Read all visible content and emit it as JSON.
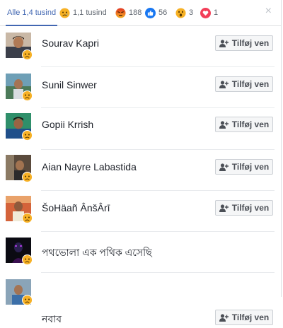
{
  "tabs": [
    {
      "id": "all",
      "label": "Alle 1,4 tusind",
      "active": true
    },
    {
      "id": "sad",
      "count": "1,1 tusind",
      "icon": "sad-reaction-icon",
      "color": "#f7b125"
    },
    {
      "id": "angry",
      "count": "188",
      "icon": "angry-reaction-icon",
      "color": "#e9710f"
    },
    {
      "id": "like",
      "count": "56",
      "icon": "like-reaction-icon",
      "color": "#1877f2"
    },
    {
      "id": "wow",
      "count": "3",
      "icon": "wow-reaction-icon",
      "color": "#f7b125"
    },
    {
      "id": "love",
      "count": "1",
      "icon": "love-reaction-icon",
      "color": "#f33e58"
    }
  ],
  "close_label": "×",
  "add_friend_label": "Tilføj ven",
  "people": [
    {
      "name": "Sourav Kapri",
      "reaction": "sad",
      "has_button": true
    },
    {
      "name": "Sunil Sinwer",
      "reaction": "sad",
      "has_button": true
    },
    {
      "name": "Gopii Krrish",
      "reaction": "sad",
      "has_button": true
    },
    {
      "name": "Aian Nayre Labastida",
      "reaction": "sad",
      "has_button": true
    },
    {
      "name": "ŠoHäañ ÂnšÂrī",
      "reaction": "sad",
      "has_button": true
    },
    {
      "name": "পথভোলা এক পথিক এসেছি",
      "reaction": "sad",
      "has_button": false
    },
    {
      "name": "নবাব",
      "reaction": "sad",
      "has_button": true
    }
  ],
  "colors": {
    "accent": "#4267b2",
    "button_bg": "#f5f6f7",
    "button_border": "#ccd0d5",
    "separator": "#e9ebee"
  }
}
